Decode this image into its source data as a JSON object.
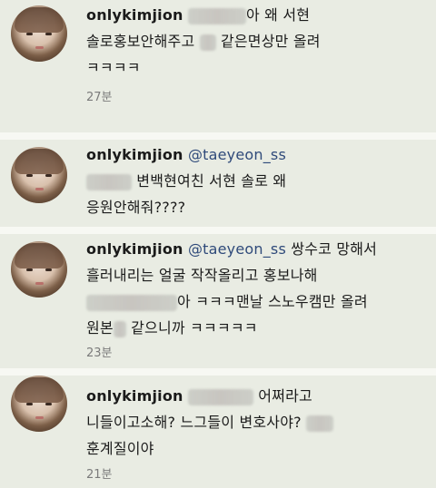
{
  "comments": [
    {
      "username": "onlykimjion",
      "lines": [
        "아 왜 서현",
        "솔로홍보안해주고",
        "같은면상만 올려",
        "ㅋㅋㅋㅋ"
      ],
      "time": "27분"
    },
    {
      "username": "onlykimjion",
      "mention": "@taeyeon_ss",
      "lines": [
        "변백현여친 서현 솔로 왜",
        "응원안해줘????"
      ],
      "time": ""
    },
    {
      "username": "onlykimjion",
      "mention": "@taeyeon_ss",
      "lines": [
        "쌍수코 망해서",
        "흘러내리는 얼굴 작작올리고 홍보나해",
        "아 ㅋㅋㅋ맨날 스노우캠만 올려",
        "원본",
        "같으니까 ㅋㅋㅋㅋㅋ"
      ],
      "time": "23분"
    },
    {
      "username": "onlykimjion",
      "lines": [
        "어쩌라고",
        "니들이고소해? 느그들이 변호사야?",
        "훈계질이야"
      ],
      "time": "21분"
    }
  ]
}
